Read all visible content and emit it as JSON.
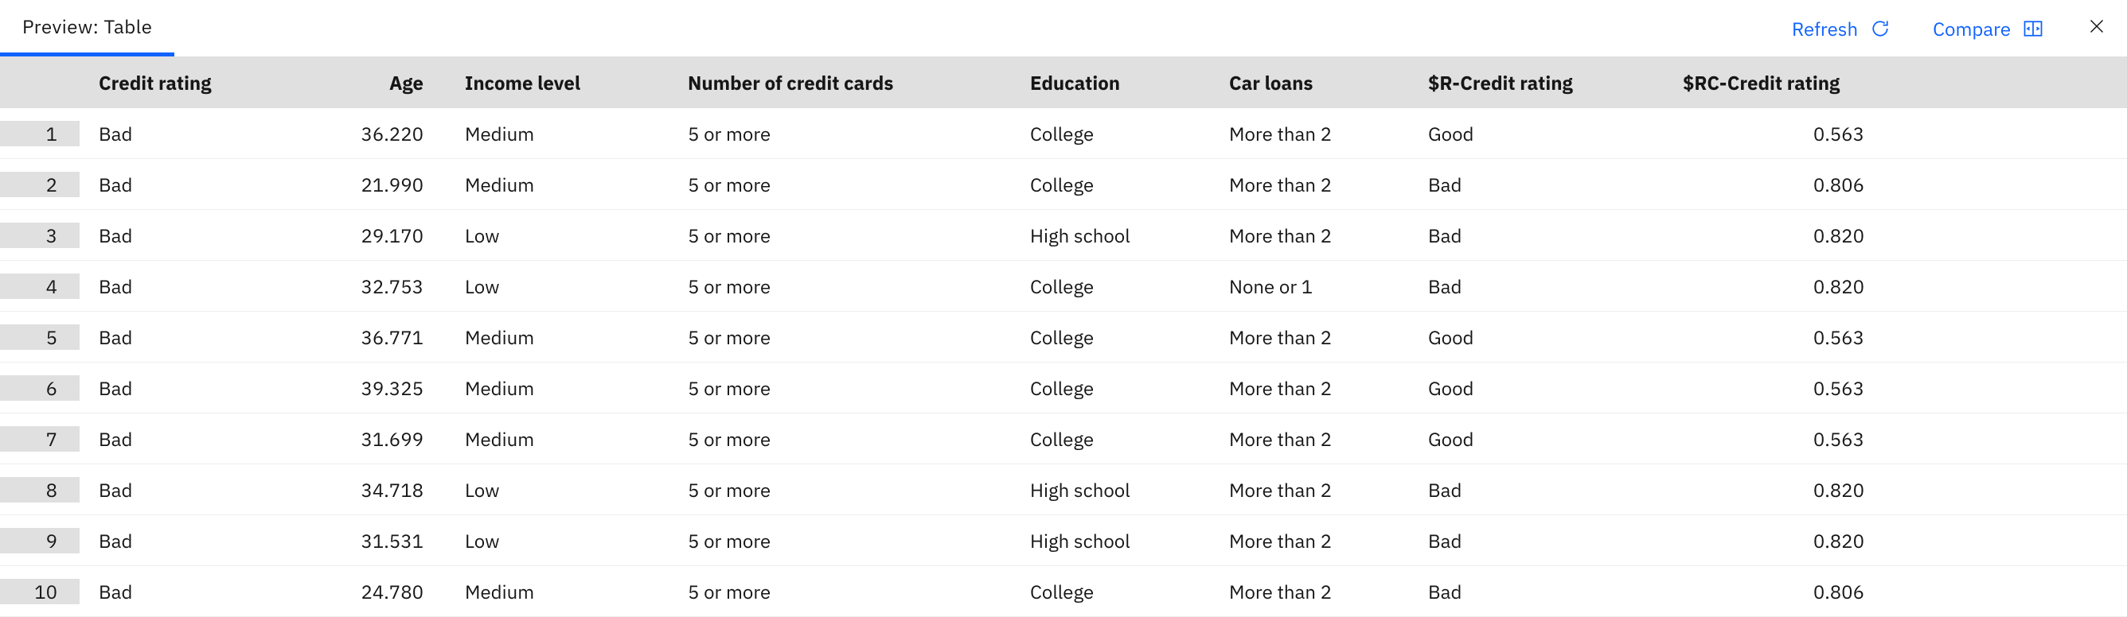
{
  "topbar": {
    "title": "Preview: Table",
    "refresh_label": "Refresh",
    "compare_label": "Compare"
  },
  "columns": {
    "credit_rating": "Credit rating",
    "age": "Age",
    "income_level": "Income level",
    "num_cards": "Number of credit cards",
    "education": "Education",
    "car_loans": "Car loans",
    "r_credit": "$R-Credit rating",
    "rc_credit": "$RC-Credit rating"
  },
  "rows": [
    {
      "n": "1",
      "credit_rating": "Bad",
      "age": "36.220",
      "income": "Medium",
      "cards": "5 or more",
      "edu": "College",
      "car": "More than 2",
      "r": "Good",
      "rc": "0.563"
    },
    {
      "n": "2",
      "credit_rating": "Bad",
      "age": "21.990",
      "income": "Medium",
      "cards": "5 or more",
      "edu": "College",
      "car": "More than 2",
      "r": "Bad",
      "rc": "0.806"
    },
    {
      "n": "3",
      "credit_rating": "Bad",
      "age": "29.170",
      "income": "Low",
      "cards": "5 or more",
      "edu": "High school",
      "car": "More than 2",
      "r": "Bad",
      "rc": "0.820"
    },
    {
      "n": "4",
      "credit_rating": "Bad",
      "age": "32.753",
      "income": "Low",
      "cards": "5 or more",
      "edu": "College",
      "car": "None or 1",
      "r": "Bad",
      "rc": "0.820"
    },
    {
      "n": "5",
      "credit_rating": "Bad",
      "age": "36.771",
      "income": "Medium",
      "cards": "5 or more",
      "edu": "College",
      "car": "More than 2",
      "r": "Good",
      "rc": "0.563"
    },
    {
      "n": "6",
      "credit_rating": "Bad",
      "age": "39.325",
      "income": "Medium",
      "cards": "5 or more",
      "edu": "College",
      "car": "More than 2",
      "r": "Good",
      "rc": "0.563"
    },
    {
      "n": "7",
      "credit_rating": "Bad",
      "age": "31.699",
      "income": "Medium",
      "cards": "5 or more",
      "edu": "College",
      "car": "More than 2",
      "r": "Good",
      "rc": "0.563"
    },
    {
      "n": "8",
      "credit_rating": "Bad",
      "age": "34.718",
      "income": "Low",
      "cards": "5 or more",
      "edu": "High school",
      "car": "More than 2",
      "r": "Bad",
      "rc": "0.820"
    },
    {
      "n": "9",
      "credit_rating": "Bad",
      "age": "31.531",
      "income": "Low",
      "cards": "5 or more",
      "edu": "High school",
      "car": "More than 2",
      "r": "Bad",
      "rc": "0.820"
    },
    {
      "n": "10",
      "credit_rating": "Bad",
      "age": "24.780",
      "income": "Medium",
      "cards": "5 or more",
      "edu": "College",
      "car": "More than 2",
      "r": "Bad",
      "rc": "0.806"
    }
  ]
}
